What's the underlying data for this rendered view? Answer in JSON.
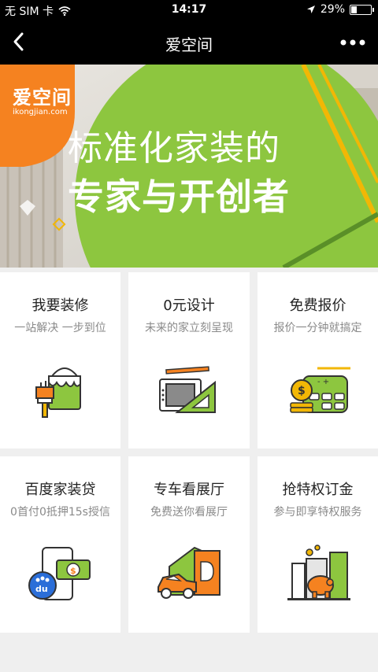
{
  "status_bar": {
    "carrier": "无 SIM 卡",
    "time": "14:17",
    "battery_percent": "29%",
    "battery_level": 0.29
  },
  "nav": {
    "title": "爱空间"
  },
  "banner": {
    "logo_text": "爱空间",
    "logo_domain": "ikongjian.com",
    "headline_1": "标准化家装的",
    "headline_2": "专家与开创者",
    "accent_green": "#8dc63f",
    "accent_orange": "#f58220"
  },
  "cards": [
    {
      "title": "我要装修",
      "subtitle": "一站解决 一步到位",
      "icon": "paint-bucket-icon"
    },
    {
      "title": "0元设计",
      "subtitle": "未来的家立刻呈现",
      "icon": "design-tools-icon"
    },
    {
      "title": "免费报价",
      "subtitle": "报价一分钟就搞定",
      "icon": "calculator-coin-icon"
    },
    {
      "title": "百度家装贷",
      "subtitle": "0首付0抵押15s授信",
      "icon": "baidu-loan-icon"
    },
    {
      "title": "专车看展厅",
      "subtitle": "免费送你看展厅",
      "icon": "car-showroom-icon"
    },
    {
      "title": "抢特权订金",
      "subtitle": "参与即享特权服务",
      "icon": "piggy-bank-icon"
    }
  ]
}
